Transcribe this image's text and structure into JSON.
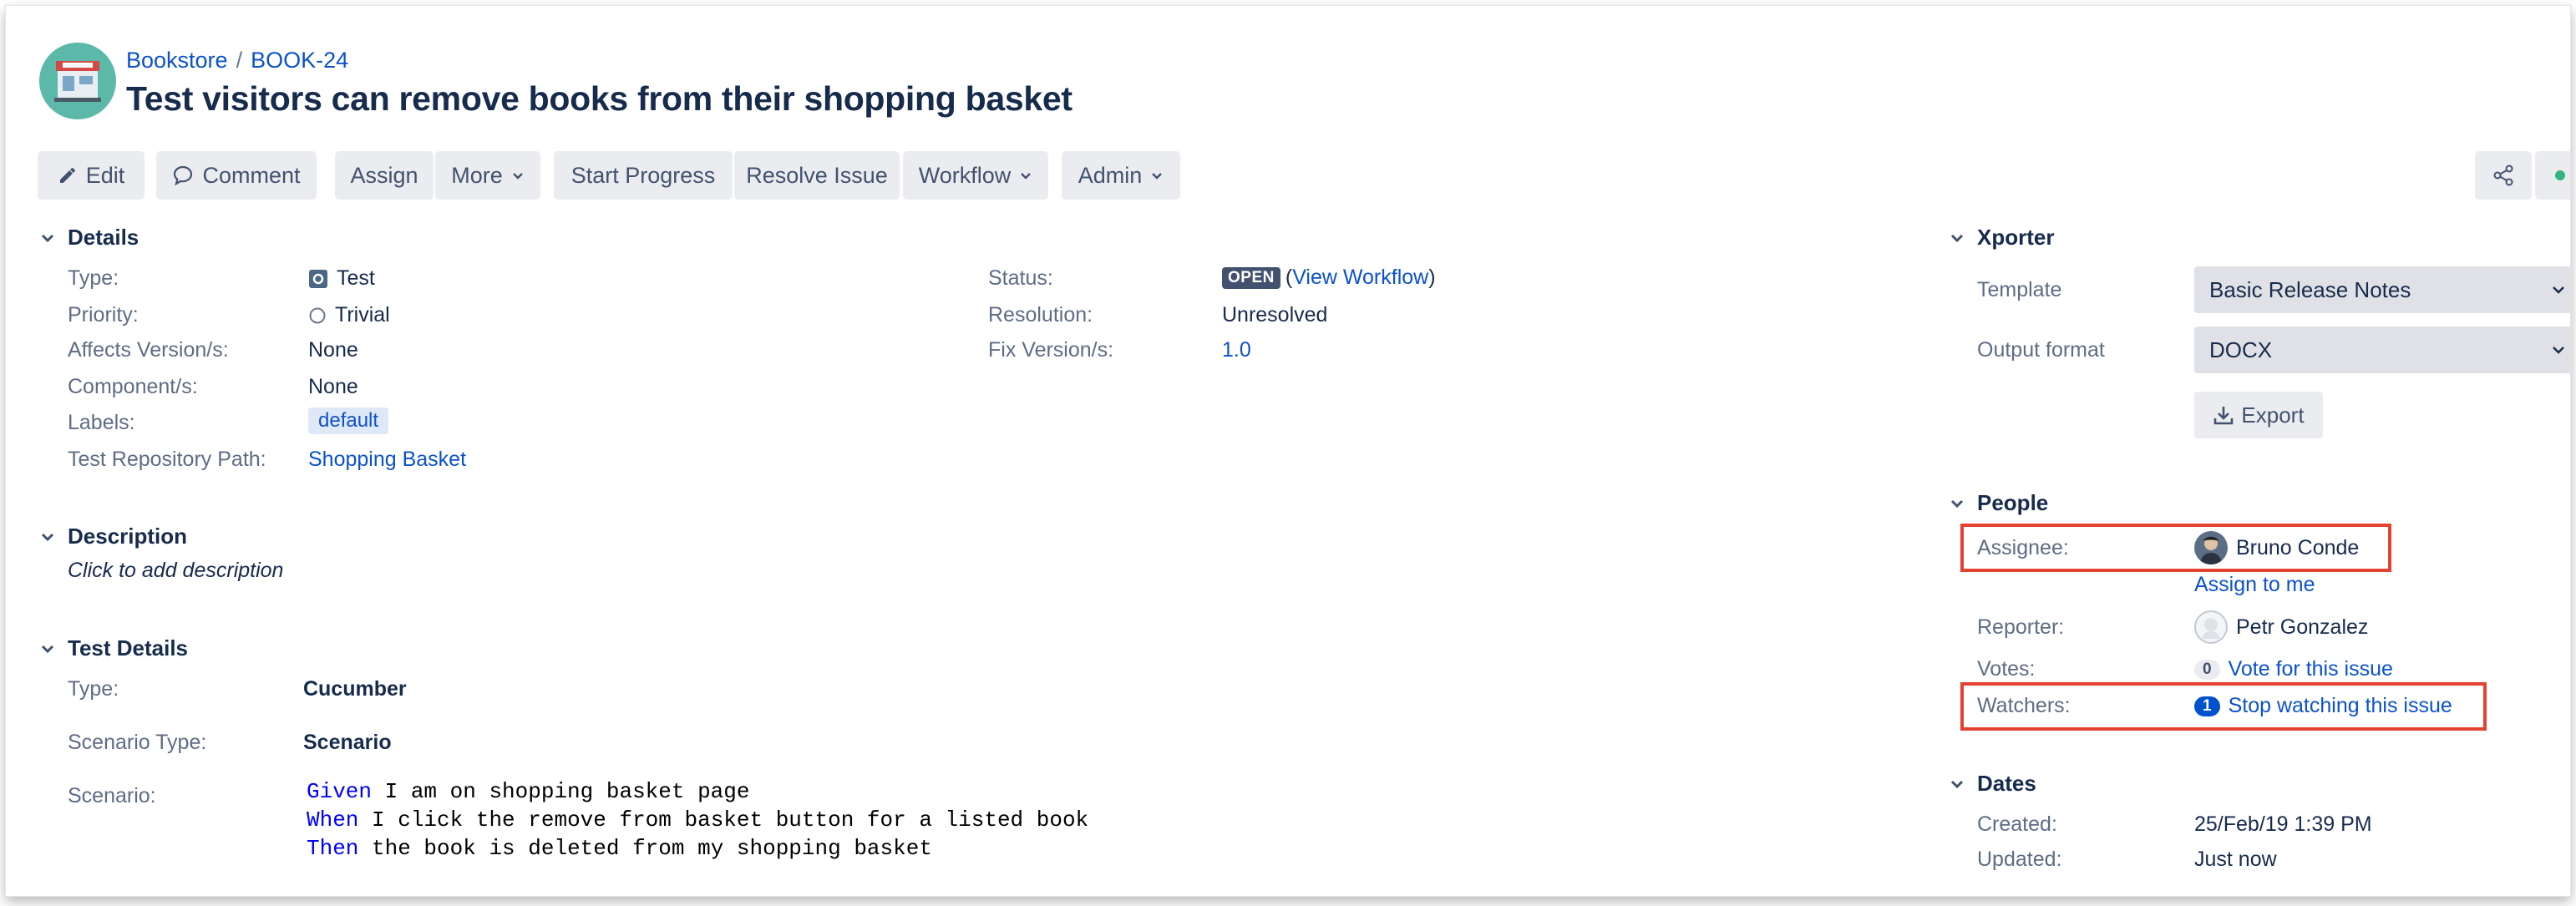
{
  "breadcrumb": {
    "project": "Bookstore",
    "separator": "/",
    "issue_key": "BOOK-24"
  },
  "issue_title": "Test visitors can remove books from their shopping basket",
  "toolbar": {
    "edit": "Edit",
    "comment": "Comment",
    "assign": "Assign",
    "more": "More",
    "start_progress": "Start Progress",
    "resolve_issue": "Resolve Issue",
    "workflow": "Workflow",
    "admin": "Admin"
  },
  "details": {
    "heading": "Details",
    "type_label": "Type:",
    "type_value": "Test",
    "priority_label": "Priority:",
    "priority_value": "Trivial",
    "affects_label": "Affects Version/s:",
    "affects_value": "None",
    "components_label": "Component/s:",
    "components_value": "None",
    "labels_label": "Labels:",
    "labels_value": "default",
    "repo_label": "Test Repository Path:",
    "repo_value": "Shopping Basket",
    "status_label": "Status:",
    "status_value": "OPEN",
    "view_workflow_open": "(",
    "view_workflow": "View Workflow",
    "view_workflow_close": ")",
    "resolution_label": "Resolution:",
    "resolution_value": "Unresolved",
    "fix_label": "Fix Version/s:",
    "fix_value": "1.0"
  },
  "description": {
    "heading": "Description",
    "placeholder": "Click to add description"
  },
  "test_details": {
    "heading": "Test Details",
    "type_label": "Type:",
    "type_value": "Cucumber",
    "scenario_type_label": "Scenario Type:",
    "scenario_type_value": "Scenario",
    "scenario_label": "Scenario:",
    "lines": [
      {
        "keyword": "Given",
        "text": " I am on shopping basket page"
      },
      {
        "keyword": "When",
        "text": " I click the remove from basket button for a listed book"
      },
      {
        "keyword": "Then",
        "text": " the book is deleted from my shopping basket"
      }
    ]
  },
  "xporter": {
    "heading": "Xporter",
    "template_label": "Template",
    "template_value": "Basic Release Notes",
    "format_label": "Output format",
    "format_value": "DOCX",
    "export": "Export"
  },
  "people": {
    "heading": "People",
    "assignee_label": "Assignee:",
    "assignee_value": "Bruno Conde",
    "assign_to_me": "Assign to me",
    "reporter_label": "Reporter:",
    "reporter_value": "Petr Gonzalez",
    "votes_label": "Votes:",
    "votes_count": "0",
    "vote_link": "Vote for this issue",
    "watchers_label": "Watchers:",
    "watchers_count": "1",
    "watch_link": "Stop watching this issue"
  },
  "dates": {
    "heading": "Dates",
    "created_label": "Created:",
    "created_value": "25/Feb/19 1:39 PM",
    "updated_label": "Updated:",
    "updated_value": "Just now"
  },
  "colors": {
    "link": "#0b52cc",
    "highlight": "#e34230",
    "project_avatar": "#5cb8a9",
    "button_bg": "#ebecf0"
  }
}
